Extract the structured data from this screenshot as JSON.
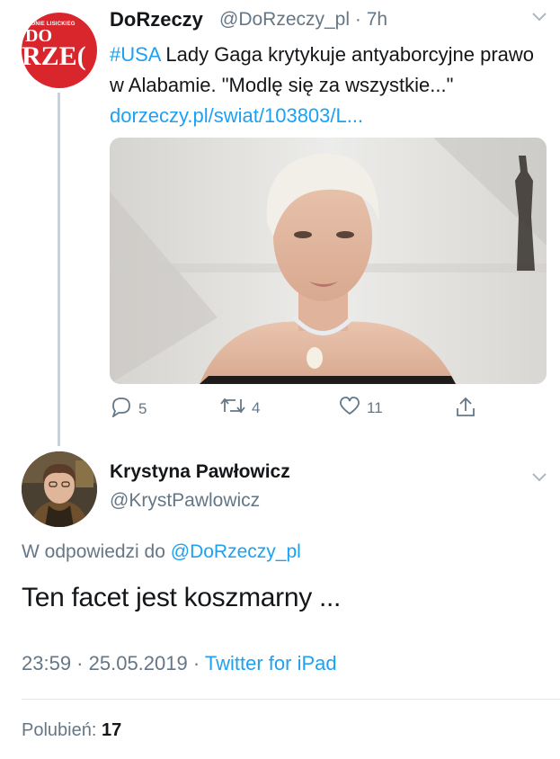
{
  "tweet1": {
    "account_name": "DoRzeczy",
    "handle": "@DoRzeczy_pl",
    "separator": "·",
    "time": "7h",
    "hashtag": "#USA",
    "text": " Lady Gaga krytykuje antyaborcyjne prawo w Alabamie. \"Modlę się za wszystkie...\" ",
    "link": "dorzeczy.pl/swiat/103803/L...",
    "avatar_logo": {
      "small": "CONIE LISICKIEG",
      "line1": "DO",
      "line2": "RZE("
    },
    "actions": {
      "reply_count": "5",
      "retweet_count": "4",
      "like_count": "11"
    }
  },
  "tweet2": {
    "account_name": "Krystyna Pawłowicz",
    "handle": "@KrystPawlowicz",
    "reply_prefix": "W odpowiedzi do ",
    "reply_handle": "@DoRzeczy_pl",
    "text": "Ten facet jest koszmarny ...",
    "time": "23:59",
    "sep1": " · ",
    "date": "25.05.2019",
    "sep2": " · ",
    "client": "Twitter for iPad",
    "likes_label": "Polubień: ",
    "likes_count": "17"
  },
  "colors": {
    "link": "#1da1f2",
    "secondary_text": "#657786",
    "brand_red": "#d9262c"
  }
}
